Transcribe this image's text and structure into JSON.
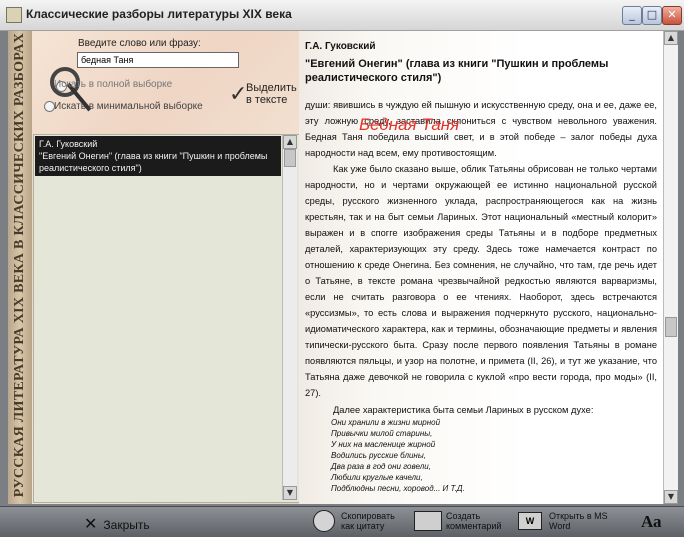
{
  "window": {
    "title": "Классические разборы литературы XIX века"
  },
  "sidebar": {
    "spine_title": "РУССКАЯ ЛИТЕРАТУРА XIX ВЕКА В КЛАССИЧЕСКИХ РАЗБОРАХ",
    "search_label": "Введите слово или фразу:",
    "search_value": "бедная Таня",
    "option_full": "Искать в полной выборке",
    "option_min": "Искать в минимальной выборке",
    "highlight_label_1": "Выделить",
    "highlight_label_2": "в тексте",
    "results": [
      {
        "line1": "Г.А. Гуковский",
        "line2": "\"Евгений Онегин\" (глава из книги \"Пушкин и проблемы реалистического стиля\")"
      }
    ]
  },
  "document": {
    "author": "Г.А. Гуковский",
    "title": "\"Евгений Онегин\" (глава из книги \"Пушкин и проблемы реалистического стиля\")",
    "search_hit": "Бедная Таня",
    "para1": "души: явившись в чуждую ей пышную и искусственную среду, она и ее, даже ее, эту ложную среду, заставила склониться с чувством невольного уважения. Бедная Таня победила высший свет, и в этой победе – залог победы духа народности над всем, ему противостоящим.",
    "para2": "Как уже было сказано выше, облик Татьяны обрисован не только чертами народности, но и чертами окружающей ее истинно национальной русской среды, русского жизненного уклада, распространяющегося как на жизнь крестьян, так и на быт семьи Лариных. Этот национальный «местный колорит» выражен и в спогге изображения среды Татьяны и в подборе предметных деталей, характеризующих эту среду. Здесь тоже намечается контраст по отношению к среде Онегина. Без сомнения, не случайно, что там, где речь идет о Татьяне, в тексте романа чрезвычайной редкостью являются варваризмы, если не считать разговора о ее чтениях. Наоборот, здесь встречаются «руссизмы», то есть слова и выражения подчеркнуто русского, национально-идиоматического характера, как и термины, обозначающие предметы и явления типически-русского быта. Сразу после первого появления Татьяны в романе появляются пяльцы, и узор на полотне, и примета (II, 26), и тут же указание, что Татьяна даже девочкой не говорила с куклой «про вести города, про моды» (II, 27).",
    "verse_intro": "Далее характеристика быта семьи Лариных в русском духе:",
    "verses": [
      "Они хранили в жизни мирной",
      "Привычки милой старины,",
      "У них на масленице жирной",
      "Водились русские блины,",
      "Два раза в год они говели,",
      "Любили круглые качели,",
      "Подблюдны песни, хоровод... И Т.Д."
    ]
  },
  "toolbar": {
    "close_label": "Закрыть",
    "copy_label": "Скопировать как цитату",
    "comment_label": "Создать комментарий",
    "word_label": "Открыть в MS Word",
    "font_label": "Аа",
    "word_icon_text": "W"
  }
}
